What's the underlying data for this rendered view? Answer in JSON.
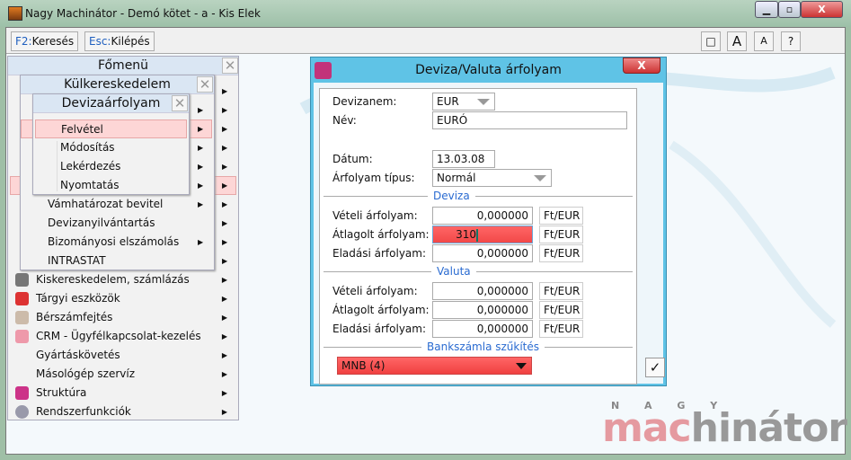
{
  "window": {
    "title": "Nagy Machinátor - Demó kötet - a - Kis Elek",
    "minimize": "▁",
    "maximize": "▫",
    "close": "X"
  },
  "toolbar": {
    "search_key": "F2:",
    "search_label": "Keresés",
    "exit_key": "Esc:",
    "exit_label": "Kilépés",
    "right_buttons": [
      "□",
      "A",
      "A",
      "?"
    ]
  },
  "main_menu": {
    "title": "Főmenü",
    "close": "✕",
    "items": [
      {
        "label": "Kiskereskedelem, számlázás",
        "icon": "cash-register-icon"
      },
      {
        "label": "Tárgyi eszközök",
        "icon": "house-icon"
      },
      {
        "label": "Bérszámfejtés",
        "icon": "payroll-icon"
      },
      {
        "label": "CRM - Ügyfélkapcsolat-kezelés",
        "icon": "people-icon"
      },
      {
        "label": "Gyártáskövetés",
        "icon": ""
      },
      {
        "label": "Másológép szervíz",
        "icon": ""
      },
      {
        "label": "Struktúra",
        "icon": "cube-icon"
      },
      {
        "label": "Rendszerfunkciók",
        "icon": "gears-icon"
      }
    ]
  },
  "kulker_menu": {
    "title": "Külkereskedelem",
    "close": "✕",
    "items": [
      "Vámhatározat bevitel",
      "Devizanyilvántartás",
      "Bizományosi elszámolás",
      "INTRASTAT"
    ]
  },
  "deviza_menu": {
    "title": "Devizaárfolyam",
    "close": "✕",
    "items": [
      "Felvétel",
      "Módosítás",
      "Lekérdezés",
      "Nyomtatás"
    ],
    "selected": "Felvétel"
  },
  "dialog": {
    "title": "Deviza/Valuta árfolyam",
    "close": "X",
    "devizanem_label": "Devizanem:",
    "devizanem": "EUR",
    "nev_label": "Név:",
    "nev": "EURÓ",
    "datum_label": "Dátum:",
    "datum": "13.03.08",
    "tipus_label": "Árfolyam típus:",
    "tipus": "Normál",
    "deviza_section": "Deviza",
    "deviza": {
      "veteli_label": "Vételi árfolyam:",
      "veteli": "0,000000",
      "atlag_label": "Átlagolt árfolyam:",
      "atlag": "310",
      "eladasi_label": "Eladási árfolyam:",
      "eladasi": "0,000000",
      "unit": "Ft/EUR"
    },
    "valuta_section": "Valuta",
    "valuta": {
      "veteli_label": "Vételi árfolyam:",
      "veteli": "0,000000",
      "atlag_label": "Átlagolt árfolyam:",
      "atlag": "0,000000",
      "eladasi_label": "Eladási árfolyam:",
      "eladasi": "0,000000",
      "unit": "Ft/EUR"
    },
    "bank_section": "Bankszámla szűkítés",
    "bank": "MNB (4)",
    "ok": "✓",
    "error_color": "#f25555"
  },
  "logo": {
    "small": "N A G Y",
    "pink": "mac",
    "gray": "hinátor"
  }
}
